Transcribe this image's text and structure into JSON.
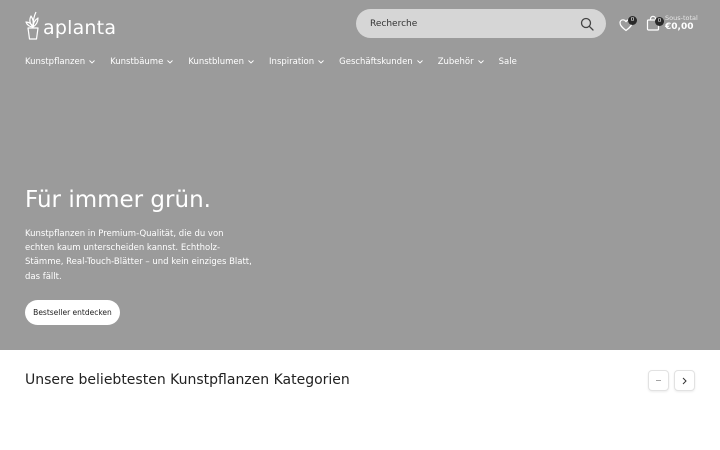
{
  "header": {
    "logo_text": "aplanta",
    "search": {
      "placeholder": "Recherche"
    },
    "wishlist": {
      "count": "0"
    },
    "cart": {
      "count": "0",
      "label": "Sous-total",
      "total": "€0,00"
    }
  },
  "nav": {
    "items": [
      {
        "label": "Kunstpflanzen",
        "dropdown": true
      },
      {
        "label": "Kunstbäume",
        "dropdown": true
      },
      {
        "label": "Kunstblumen",
        "dropdown": true
      },
      {
        "label": "Inspiration",
        "dropdown": true
      },
      {
        "label": "Geschäftskunden",
        "dropdown": true
      },
      {
        "label": "Zubehör",
        "dropdown": true
      },
      {
        "label": "Sale",
        "dropdown": false
      }
    ]
  },
  "hero": {
    "title": "Für immer grün.",
    "text": "Kunstpflanzen in Premium-Qualität, die du von echten kaum unterscheiden kannst. Echtholz-Stämme, Real-Touch-Blätter – und kein einziges Blatt, das fällt.",
    "button_label": "Bestseller entdecken"
  },
  "categories": {
    "title": "Unsere beliebtesten Kunstpflanzen Kategorien"
  },
  "colors": {
    "hero_background": "#9b9b9b",
    "search_background": "#d6d6d6",
    "badge": "#2a2a2a"
  },
  "icons": [
    "plant-logo-icon",
    "search-icon",
    "heart-icon",
    "bag-icon",
    "chevron-down-icon",
    "minus-icon",
    "chevron-right-icon"
  ]
}
